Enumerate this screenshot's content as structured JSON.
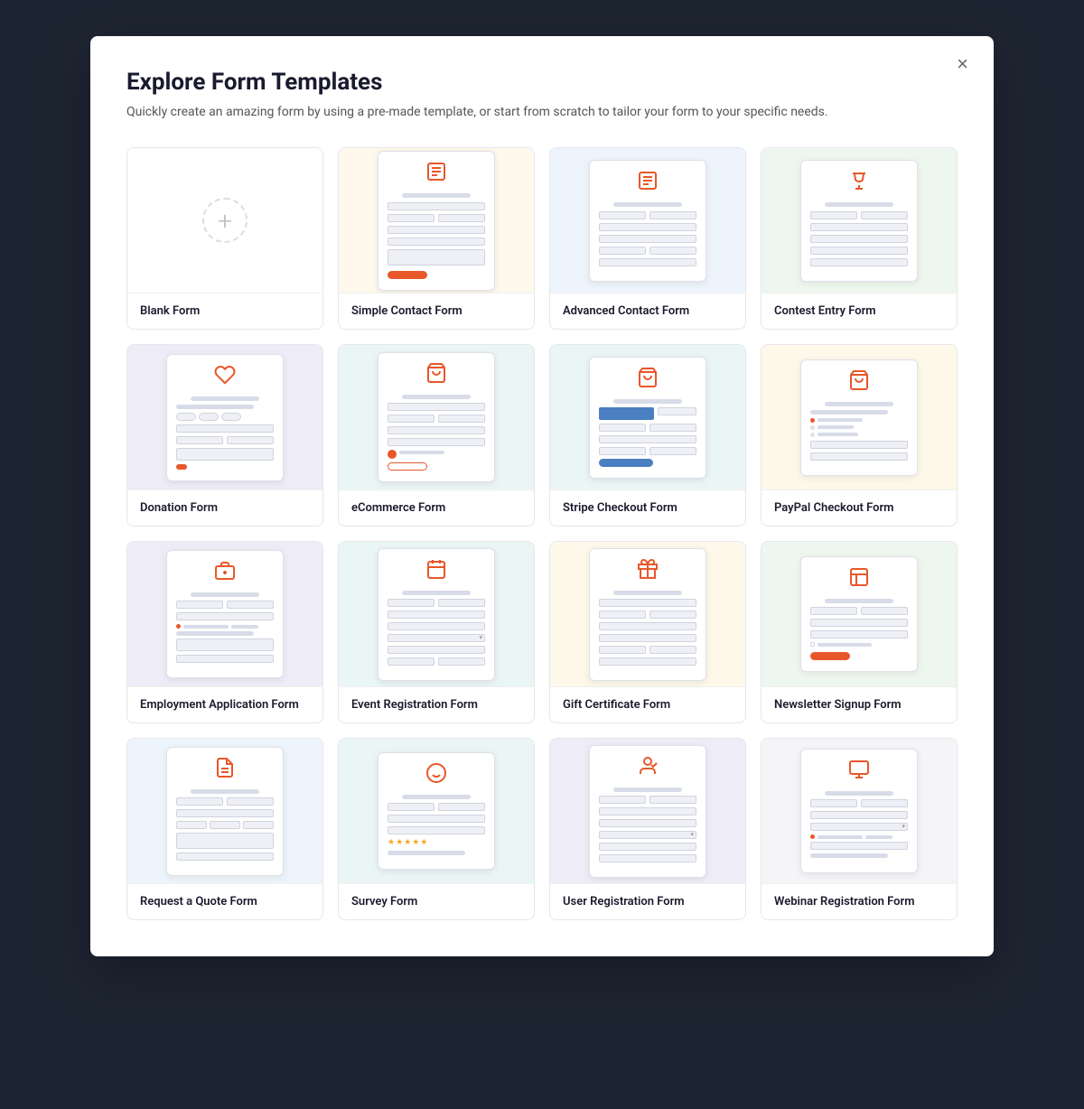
{
  "modal": {
    "title": "Explore Form Templates",
    "subtitle": "Quickly create an amazing form by using a pre-made template, or start from scratch to tailor your form to your specific needs.",
    "close_label": "×"
  },
  "templates": [
    {
      "id": "blank",
      "label": "Blank Form",
      "bg": "bg-white",
      "type": "blank"
    },
    {
      "id": "simple-contact",
      "label": "Simple Contact Form",
      "bg": "bg-cream",
      "type": "contact-simple"
    },
    {
      "id": "advanced-contact",
      "label": "Advanced Contact Form",
      "bg": "bg-light-blue",
      "type": "contact-advanced"
    },
    {
      "id": "contest-entry",
      "label": "Contest Entry Form",
      "bg": "bg-light-green",
      "type": "contest"
    },
    {
      "id": "donation",
      "label": "Donation Form",
      "bg": "bg-light-purple",
      "type": "donation"
    },
    {
      "id": "ecommerce",
      "label": "eCommerce Form",
      "bg": "bg-light-teal",
      "type": "ecommerce"
    },
    {
      "id": "stripe-checkout",
      "label": "Stripe Checkout Form",
      "bg": "bg-light-teal",
      "type": "stripe"
    },
    {
      "id": "paypal-checkout",
      "label": "PayPal Checkout Form",
      "bg": "bg-light-yellow",
      "type": "paypal"
    },
    {
      "id": "employment",
      "label": "Employment Application Form",
      "bg": "bg-light-purple",
      "type": "employment"
    },
    {
      "id": "event-registration",
      "label": "Event Registration Form",
      "bg": "bg-light-teal",
      "type": "event"
    },
    {
      "id": "gift-certificate",
      "label": "Gift Certificate Form",
      "bg": "bg-light-yellow",
      "type": "gift"
    },
    {
      "id": "newsletter",
      "label": "Newsletter Signup Form",
      "bg": "bg-light-green",
      "type": "newsletter"
    },
    {
      "id": "quote",
      "label": "Request a Quote Form",
      "bg": "bg-light-blue",
      "type": "quote"
    },
    {
      "id": "survey",
      "label": "Survey Form",
      "bg": "bg-light-teal",
      "type": "survey"
    },
    {
      "id": "user-registration",
      "label": "User Registration Form",
      "bg": "bg-light-purple",
      "type": "user-reg"
    },
    {
      "id": "webinar",
      "label": "Webinar Registration Form",
      "bg": "bg-light-gray",
      "type": "webinar"
    }
  ]
}
